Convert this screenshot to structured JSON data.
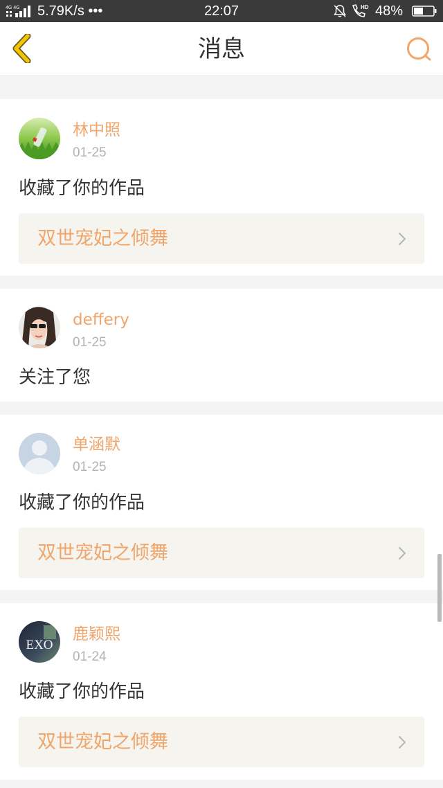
{
  "status_bar": {
    "network": "4G 4G",
    "speed": "5.79K/s •••",
    "time": "22:07",
    "battery": "48%",
    "battery_level": 0.48
  },
  "header": {
    "title": "消息"
  },
  "colors": {
    "accent": "#f0a56b",
    "back_arrow": "#f2c500",
    "text": "#333333",
    "muted": "#b3b3b3",
    "work_bg": "#f5f4ef"
  },
  "notifications": [
    {
      "user": "林中照",
      "date": "01-25",
      "action": "收藏了你的作品",
      "work": "双世宠妃之倾舞",
      "avatar": "bottle-on-grass-avatar"
    },
    {
      "user": "deffery",
      "date": "01-25",
      "action": "关注了您",
      "avatar": "woman-sunglasses-avatar"
    },
    {
      "user": "单涵默",
      "date": "01-25",
      "action": "收藏了你的作品",
      "work": "双世宠妃之倾舞",
      "avatar": "default-person-avatar"
    },
    {
      "user": "鹿颖熙",
      "date": "01-24",
      "action": "收藏了你的作品",
      "work": "双世宠妃之倾舞",
      "avatar": "exo-logo-avatar",
      "avatar_text": "EXO"
    }
  ]
}
